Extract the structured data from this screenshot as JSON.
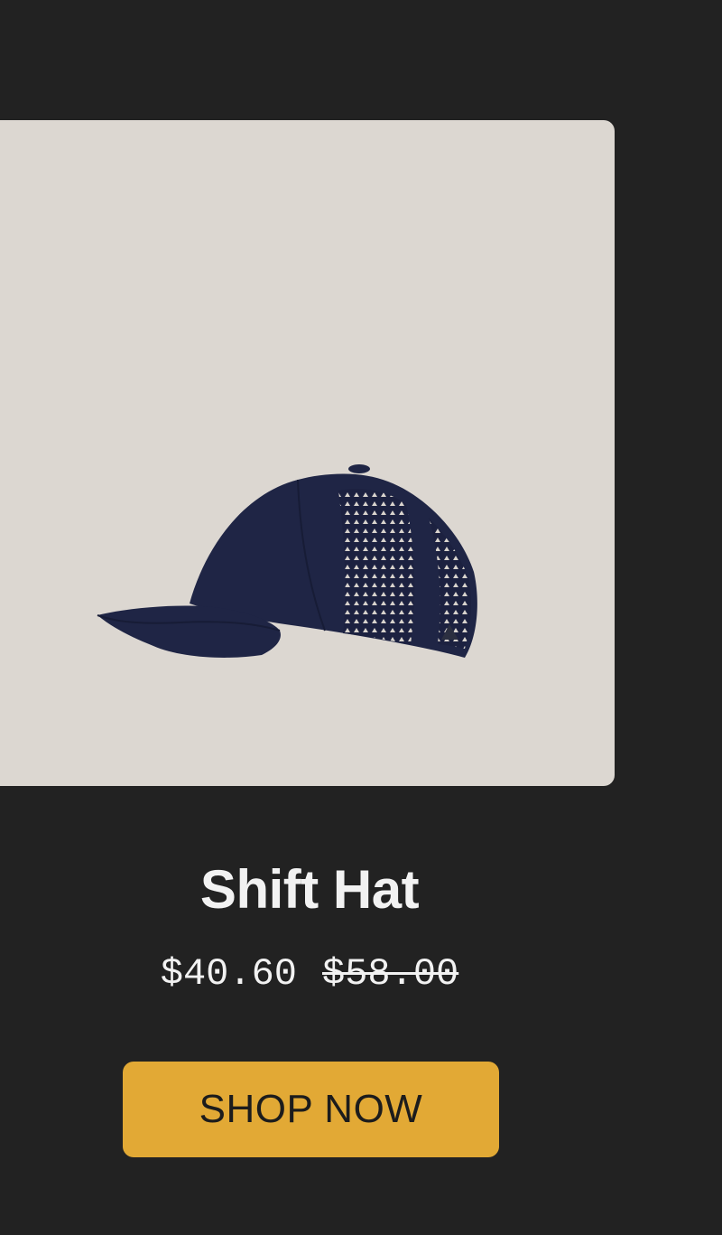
{
  "product": {
    "image_alt": "navy-perforated-cap",
    "title": "Shift Hat",
    "price_current": "$40.60",
    "price_original": "$58.00",
    "cta_label": "SHOP NOW"
  },
  "colors": {
    "background": "#222222",
    "image_card": "#dcd7d1",
    "hat": "#1f2545",
    "cta": "#e2a935",
    "text": "#f2f2f2"
  }
}
